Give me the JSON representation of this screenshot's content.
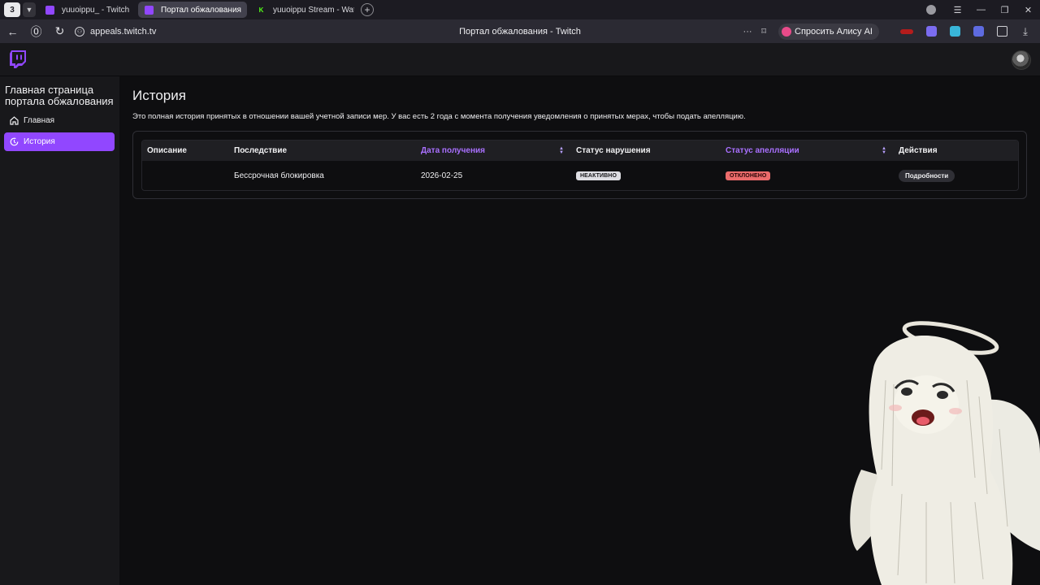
{
  "browser": {
    "tab_counter": "3",
    "tabs": [
      {
        "title": "yuuoippu_ - Twitch",
        "favicon": "twitch-icon",
        "active": false
      },
      {
        "title": "Портал обжалования",
        "favicon": "twitch-icon",
        "active": true
      },
      {
        "title": "yuuoippu Stream - Watch",
        "favicon": "kick-icon",
        "active": false
      }
    ],
    "url": "appeals.twitch.tv",
    "page_title": "Портал обжалования - Twitch",
    "alisa_button": "Спросить Алису AI"
  },
  "sidebar": {
    "title": "Главная страница портала обжалования",
    "items": [
      {
        "label": "Главная",
        "icon": "home-icon",
        "active": false
      },
      {
        "label": "История",
        "icon": "history-icon",
        "active": true
      }
    ]
  },
  "main": {
    "title": "История",
    "description": "Это полная история принятых в отношении вашей учетной записи мер. У вас есть 2 года с момента получения уведомления о принятых мерах, чтобы подать апелляцию.",
    "table": {
      "headers": [
        "Описание",
        "Последствие",
        "Дата получения",
        "Статус нарушения",
        "Статус апелляции",
        "Действия"
      ],
      "rows": [
        {
          "description": "",
          "consequence": "Бессрочная блокировка",
          "date": "2026-02-25",
          "violation_status": "НЕАКТИВНО",
          "appeal_status": "ОТКЛОНЕНО",
          "action": "Подробности"
        }
      ]
    }
  },
  "colors": {
    "twitch_purple": "#9147ff",
    "sort_header": "#a970ff",
    "rejected": "#eb6b6b",
    "inactive": "#dedee3"
  }
}
